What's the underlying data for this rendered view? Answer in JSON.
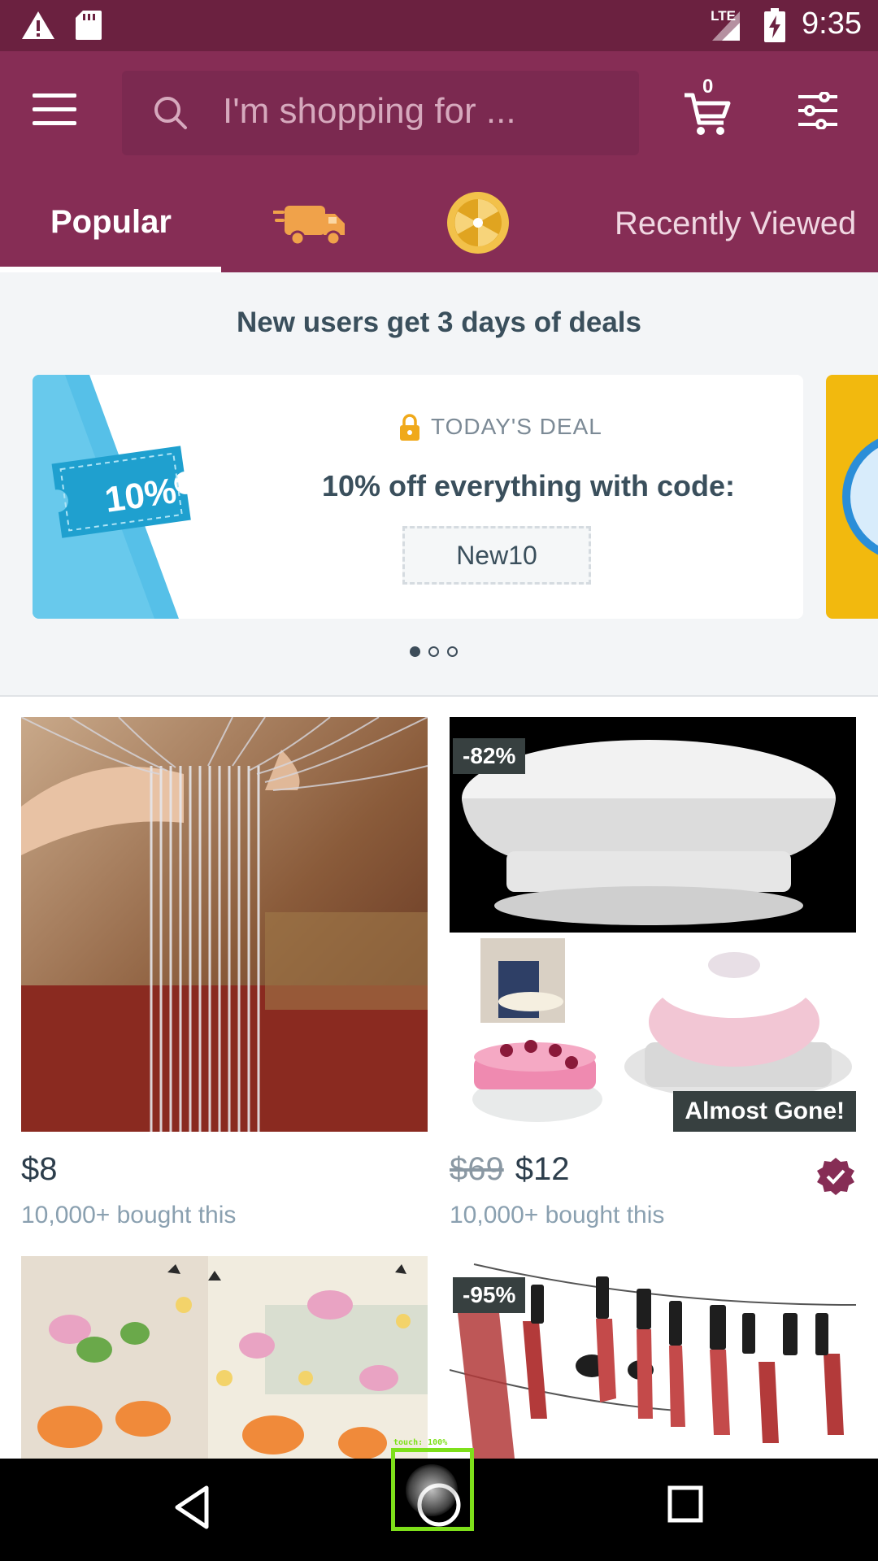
{
  "status_bar": {
    "time": "9:35",
    "network": "LTE"
  },
  "search": {
    "placeholder": "I'm shopping for ..."
  },
  "cart": {
    "count": "0"
  },
  "tabs": [
    {
      "label": "Popular",
      "selected": true
    },
    {
      "icon": "delivery-truck-icon"
    },
    {
      "icon": "prize-wheel-icon"
    },
    {
      "label": "Recently Viewed"
    }
  ],
  "promo": {
    "headline": "New users get 3 days of deals",
    "badge_text": "10%",
    "tag": "TODAY'S DEAL",
    "title": "10% off everything with code:",
    "code": "New10",
    "pages": 3,
    "active_page": 1
  },
  "products": [
    {
      "price": "$8",
      "bought": "10,000+ bought this"
    },
    {
      "discount": "-82%",
      "old_price": "$69",
      "price": "$12",
      "badge": "Almost Gone!",
      "bought": "10,000+ bought this"
    },
    {},
    {
      "discount": "-95%"
    }
  ],
  "colors": {
    "brand": "#862d55",
    "status_bar": "#6b2140",
    "touch_indicator": "#7ee01a"
  },
  "touch_indicator": {
    "label": "touch: 100%"
  }
}
